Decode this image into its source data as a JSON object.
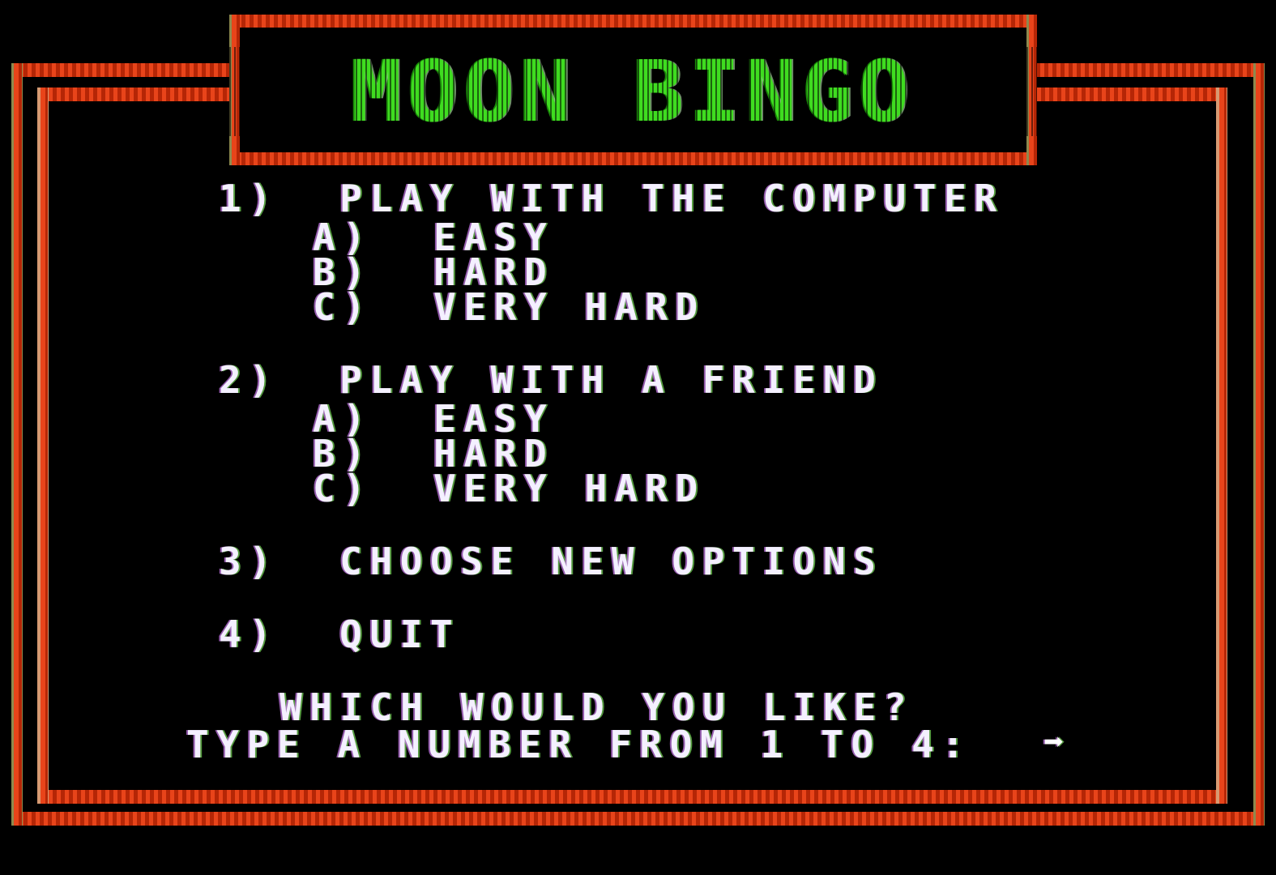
{
  "app": {
    "title": "MOON BINGO",
    "screen_name": "main-menu"
  },
  "colors": {
    "background": "#000000",
    "border_bright": "#e8441a",
    "border_dark": "#b52606",
    "border_highlight": "#8d8a4e",
    "title_green": "#3fdc20",
    "text_white": "#f4f0ff"
  },
  "menu": {
    "options": [
      {
        "number": "1)",
        "label": "PLAY WITH THE COMPUTER",
        "sub": [
          {
            "key": "A)",
            "label": "EASY"
          },
          {
            "key": "B)",
            "label": "HARD"
          },
          {
            "key": "C)",
            "label": "VERY HARD"
          }
        ]
      },
      {
        "number": "2)",
        "label": "PLAY WITH A FRIEND",
        "sub": [
          {
            "key": "A)",
            "label": "EASY"
          },
          {
            "key": "B)",
            "label": "HARD"
          },
          {
            "key": "C)",
            "label": "VERY HARD"
          }
        ]
      },
      {
        "number": "3)",
        "label": "CHOOSE NEW OPTIONS",
        "sub": []
      },
      {
        "number": "4)",
        "label": "QUIT",
        "sub": []
      }
    ]
  },
  "prompt": {
    "question": "WHICH WOULD YOU LIKE?",
    "instruction": "TYPE A NUMBER FROM 1 TO 4:",
    "cursor": "➡",
    "input_value": ""
  },
  "lines": {
    "opt1": "1)  PLAY WITH THE COMPUTER",
    "opt1a": "A)  EASY",
    "opt1b": "B)  HARD",
    "opt1c": "C)  VERY HARD",
    "opt2": "2)  PLAY WITH A FRIEND",
    "opt2a": "A)  EASY",
    "opt2b": "B)  HARD",
    "opt2c": "C)  VERY HARD",
    "opt3": "3)  CHOOSE NEW OPTIONS",
    "opt4": "4)  QUIT",
    "question": "WHICH WOULD YOU LIKE?",
    "instruction": "TYPE A NUMBER FROM 1 TO 4:"
  }
}
